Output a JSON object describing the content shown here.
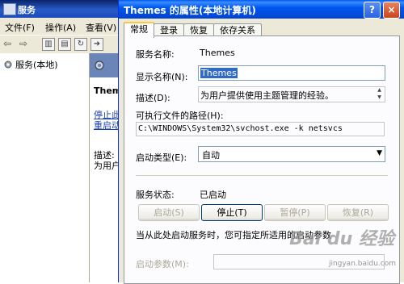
{
  "background_window": {
    "title": "服务",
    "menu": [
      "文件(F)",
      "操作(A)",
      "查看(V)"
    ],
    "tree_root": "服务(本地)",
    "service_name": "Themes",
    "links": [
      "停止此",
      "重启动"
    ],
    "desc_label": "描述:",
    "desc_text": "为用户"
  },
  "dialog": {
    "title": "Themes 的属性(本地计算机)",
    "help_btn": "?",
    "close_btn": "×",
    "tabs": [
      "常规",
      "登录",
      "恢复",
      "依存关系"
    ],
    "service_name_label": "服务名称:",
    "service_name_value": "Themes",
    "display_name_label": "显示名称(N):",
    "display_name_value": "Themes",
    "description_label": "描述(D):",
    "description_value": "为用户提供使用主题管理的经验。",
    "exe_path_label": "可执行文件的路径(H):",
    "exe_path_value": "C:\\WINDOWS\\System32\\svchost.exe -k netsvcs",
    "startup_type_label": "启动类型(E):",
    "startup_type_value": "自动",
    "status_label": "服务状态:",
    "status_value": "已启动",
    "buttons": {
      "start": "启动(S)",
      "stop": "停止(T)",
      "pause": "暂停(P)",
      "resume": "恢复(R)"
    },
    "hint_text": "当从此处启动服务时，您可指定所适用的启动参数",
    "start_params_label": "启动参数(M):",
    "start_params_value": ""
  },
  "watermark": {
    "brand": "Bai du 经验",
    "url": "jingyan.baidu.com"
  }
}
